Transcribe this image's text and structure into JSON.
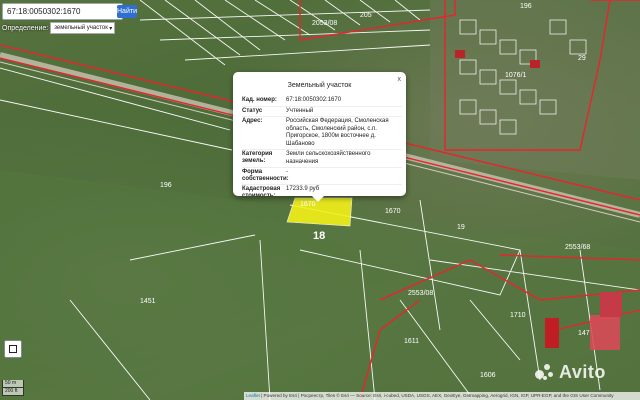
{
  "search": {
    "value": "67:18:0050302:1670",
    "button": "Найти"
  },
  "definition": {
    "label": "Определение:",
    "selected": "земельный участок"
  },
  "popup": {
    "title": "Земельный участок",
    "close": "x",
    "rows": [
      {
        "k": "Кад. номер:",
        "v": "67:18:0050302:1670"
      },
      {
        "k": "Статус",
        "v": "Учтенный"
      },
      {
        "k": "Адрес:",
        "v": "Российская Федерация, Смоленская область, Смоленский район, с.п. Пригорское, 1800м восточнее д. Шабаново"
      },
      {
        "k": "Категория земель:",
        "v": "Земли сельскохозяйственного назначения"
      },
      {
        "k": "Форма собственности:",
        "v": "-"
      },
      {
        "k": "Кадастровая стоимость:",
        "v": "17233.9 руб"
      },
      {
        "k": "Уточненная",
        "v": ""
      }
    ]
  },
  "map_labels": {
    "parcel_big": "18",
    "l1": "1670",
    "l2": "1670",
    "l3": "19",
    "l4": "205",
    "l5": "2053/08",
    "l6": "1076/1",
    "l7": "1451",
    "l8": "196",
    "l9": "1710",
    "l10": "1611",
    "l11": "1606",
    "l12": "2553/68",
    "l13": "2553/08",
    "l14": "29",
    "l15": "147",
    "l16": "196"
  },
  "scale": {
    "top": "50 m",
    "bottom": "200 ft"
  },
  "attribution": {
    "leaflet": "Leaflet",
    "text": "| Powered by Esri | Росреестр, Tiles © Esri — Source: Esri, i-cubed, USDA, USGS, AEX, GeoEye, Getmapping, Aerogrid, IGN, IGP, UPR-EGP, and the GIS User Community"
  },
  "watermark": "Avito",
  "colors": {
    "button": "#2f6fd1",
    "parcel_highlight": "#f4f11a",
    "boundary_red": "#e8242e"
  },
  "icons": {
    "fullscreen": "fullscreen-icon",
    "close": "close-icon"
  }
}
